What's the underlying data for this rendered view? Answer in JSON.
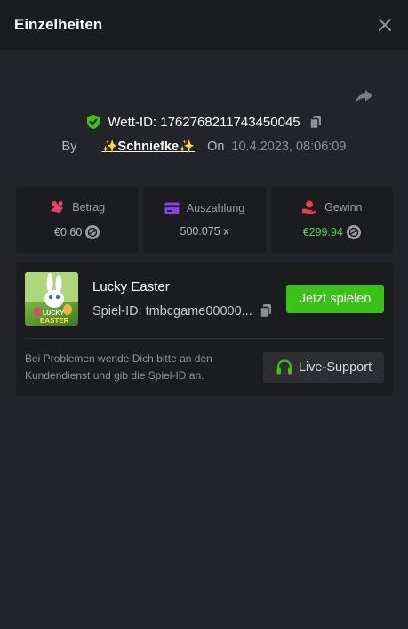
{
  "header": {
    "title": "Einzelheiten"
  },
  "bet": {
    "id_label": "Wett-ID: 1762768211743450045",
    "by_label": "By",
    "user": "✨Schniefke✨",
    "on_label": "On",
    "datetime": "10.4.2023, 08:06:09"
  },
  "stats": {
    "amount": {
      "label": "Betrag",
      "value": "€0.60",
      "icon": "chip-icon"
    },
    "payout": {
      "label": "Auszahlung",
      "value": "500.075 x",
      "icon": "card-icon"
    },
    "win": {
      "label": "Gewinn",
      "value": "€299.94",
      "icon": "hand-coin-icon"
    }
  },
  "game": {
    "name": "Lucky Easter",
    "id_label": "Spiel-ID: tmbcgame00000...",
    "play_label": "Jetzt spielen",
    "thumb_title_1": "LUCKY",
    "thumb_title_2": "EASTER"
  },
  "help": {
    "text": "Bei Problemen wende Dich bitte an den Kundendienst und gib die Spiel-ID an.",
    "support_label": "Live-Support"
  },
  "colors": {
    "accent_green": "#3bc117",
    "win_green": "#4bd84b",
    "amount_icon": "#e8416a",
    "payout_icon": "#8b3ff0",
    "win_icon": "#e8414b",
    "shield_green": "#3bc117"
  }
}
